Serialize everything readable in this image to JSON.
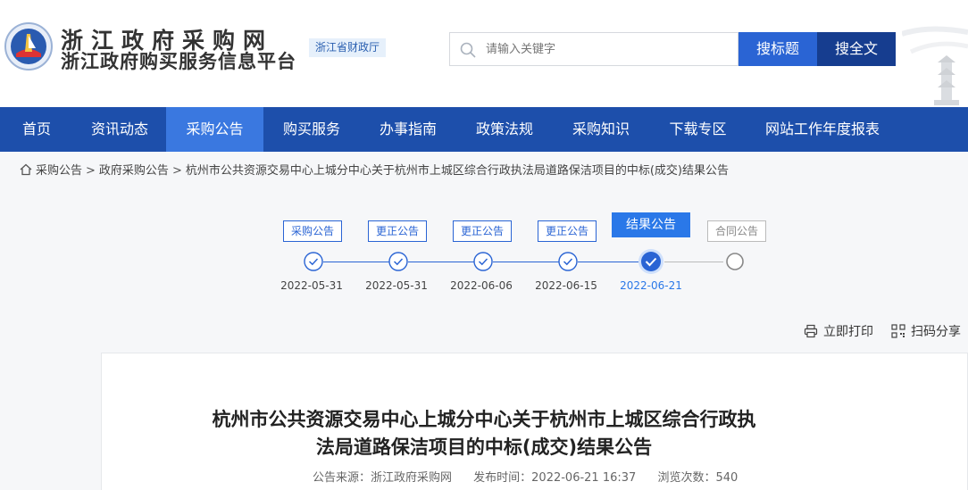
{
  "header": {
    "site_title": "浙江政府采购网",
    "site_subtitle": "浙江政府购买服务信息平台",
    "dept_badge": "浙江省财政厅",
    "search_placeholder": "请输入关键字",
    "search_title_button": "搜标题",
    "search_full_button": "搜全文"
  },
  "nav": {
    "items": [
      {
        "label": "首页"
      },
      {
        "label": "资讯动态"
      },
      {
        "label": "采购公告"
      },
      {
        "label": "购买服务"
      },
      {
        "label": "办事指南"
      },
      {
        "label": "政策法规"
      },
      {
        "label": "采购知识"
      },
      {
        "label": "下载专区"
      },
      {
        "label": "网站工作年度报表"
      }
    ],
    "active": "采购公告"
  },
  "breadcrumb": {
    "items": [
      "采购公告",
      "政府采购公告",
      "杭州市公共资源交易中心上城分中心关于杭州市上城区综合行政执法局道路保洁项目的中标(成交)结果公告"
    ],
    "separator": ">"
  },
  "timeline": {
    "steps": [
      {
        "label": "采购公告",
        "date": "2022-05-31",
        "status": "done"
      },
      {
        "label": "更正公告",
        "date": "2022-05-31",
        "status": "done"
      },
      {
        "label": "更正公告",
        "date": "2022-06-06",
        "status": "done"
      },
      {
        "label": "更正公告",
        "date": "2022-06-15",
        "status": "done"
      },
      {
        "label": "结果公告",
        "date": "2022-06-21",
        "status": "current"
      },
      {
        "label": "合同公告",
        "date": "",
        "status": "pending"
      }
    ]
  },
  "tools": {
    "print": "立即打印",
    "share": "扫码分享"
  },
  "article": {
    "title_line1": "杭州市公共资源交易中心上城分中心关于杭州市上城区综合行政执",
    "title_line2": "法局道路保洁项目的中标(成交)结果公告",
    "source": "公告来源：浙江政府采购网",
    "published": "发布时间：2022-06-21 16:37",
    "views": "浏览次数：540"
  },
  "colors": {
    "nav_bg": "#1d4fab",
    "nav_active": "#3a78e0",
    "accent": "#2a64d4",
    "button_dark": "#163d8f"
  }
}
